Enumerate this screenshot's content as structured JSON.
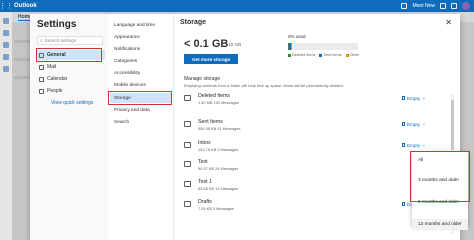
{
  "topbar": {
    "app_title": "Outlook",
    "meet_now": "Meet Now",
    "avatar_initials": "",
    "accent": "#0f6cbd"
  },
  "background": {
    "home_tab": "Home"
  },
  "settings": {
    "title": "Settings",
    "search_placeholder": "Search settings",
    "categories": [
      {
        "label": "General",
        "icon": "gear-icon",
        "active": true
      },
      {
        "label": "Mail",
        "icon": "mail-icon",
        "active": false
      },
      {
        "label": "Calendar",
        "icon": "calendar-icon",
        "active": false
      },
      {
        "label": "People",
        "icon": "people-icon",
        "active": false
      }
    ],
    "quick_settings_link": "View quick settings"
  },
  "general_menu": {
    "items": [
      {
        "label": "Language and time",
        "active": false
      },
      {
        "label": "Appearance",
        "active": false
      },
      {
        "label": "Notifications",
        "active": false
      },
      {
        "label": "Categories",
        "active": false
      },
      {
        "label": "Accessibility",
        "active": false
      },
      {
        "label": "Mobile devices",
        "active": false
      },
      {
        "label": "Storage",
        "active": true
      },
      {
        "label": "Privacy and data",
        "active": false
      },
      {
        "label": "Search",
        "active": false
      }
    ]
  },
  "storage": {
    "title": "Storage",
    "used_size": "< 0.1 GB",
    "of_total": "/ 15 GB",
    "percent_used": "0% used",
    "percent_value": 0,
    "legend": [
      {
        "label": "Deleted Items",
        "color": "#3a7d3e"
      },
      {
        "label": "Sent Items",
        "color": "#0f6cbd"
      },
      {
        "label": "Other",
        "color": "#d89614"
      }
    ],
    "get_more_button": "Get more storage",
    "manage_title": "Manage storage",
    "manage_desc": "Emptying contents from a folder will help free up space. Items will be permanently deleted.",
    "folders": [
      {
        "name": "Deleted Items",
        "meta": "1.40 MB    100 Messages",
        "action": "Empty"
      },
      {
        "name": "Sent Items",
        "meta": "454.58 KB    31 Messages",
        "action": "Empty"
      },
      {
        "name": "Inbox",
        "meta": "153.75 KB    3 Messages",
        "action": "Empty"
      },
      {
        "name": "Test",
        "meta": "59.37 KB    24 Messages",
        "action": ""
      },
      {
        "name": "Test 1",
        "meta": "63.58 KB    13 Messages",
        "action": ""
      },
      {
        "name": "Drafts",
        "meta": "7.05 KB    3 Messages",
        "action": "Empty"
      }
    ]
  },
  "empty_dropdown": {
    "options": [
      "All",
      "3 months and older",
      "6 months and older",
      "12 months and older"
    ],
    "highlighted_index": 3
  },
  "annotation_color": "#d13438"
}
